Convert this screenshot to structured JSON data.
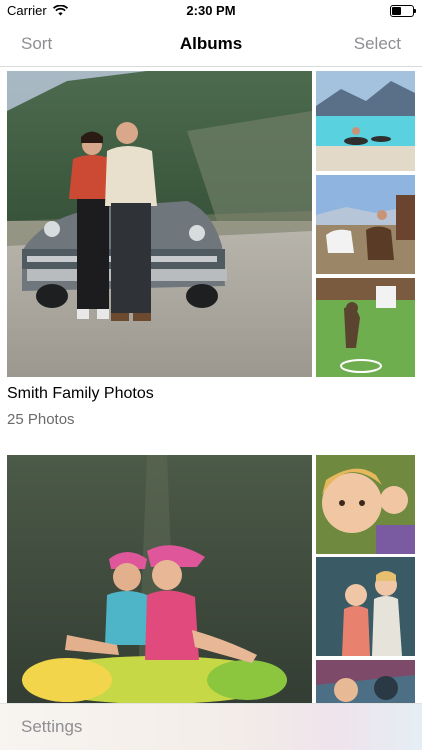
{
  "status_bar": {
    "carrier": "Carrier",
    "time": "2:30 PM",
    "icons": [
      "wifi-icon",
      "battery-icon"
    ]
  },
  "nav": {
    "left": "Sort",
    "title": "Albums",
    "right": "Select"
  },
  "albums": [
    {
      "name": "Smith Family Photos",
      "count": "25 Photos",
      "cover": "couple-with-car-photo",
      "thumbnails": [
        "pool-photo",
        "horses-photo",
        "dog-on-lawn-photo"
      ]
    },
    {
      "name": "",
      "count": "",
      "cover": "girls-on-float-photo",
      "thumbnails": [
        "child-face-photo",
        "two-children-photo",
        "child-close-up-photo"
      ]
    }
  ],
  "bottom_bar": {
    "settings": "Settings"
  }
}
